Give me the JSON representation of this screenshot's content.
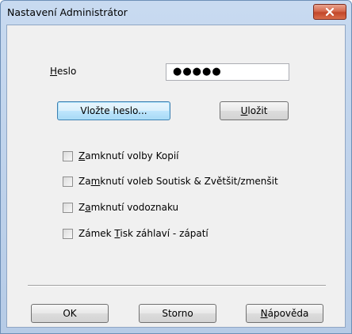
{
  "window": {
    "title": "Nastavení Administrátor"
  },
  "password": {
    "label_first": "H",
    "label_rest": "eslo",
    "value": "●●●●●"
  },
  "buttons": {
    "enter_password": "Vložte heslo...",
    "save_first": "U",
    "save_rest": "ložit",
    "ok": "OK",
    "cancel": "Storno",
    "help_first": "N",
    "help_rest": "ápověda"
  },
  "checkboxes": [
    {
      "pre": "",
      "key": "Z",
      "post": "amknutí volby Kopií",
      "checked": false
    },
    {
      "pre": "Za",
      "key": "m",
      "post": "knutí voleb Soutisk & Zvětšit/zmenšit",
      "checked": false
    },
    {
      "pre": "Z",
      "key": "a",
      "post": "mknutí vodoznaku",
      "checked": false
    },
    {
      "pre": "Zámek ",
      "key": "T",
      "post": "isk záhlaví - zápatí",
      "checked": false
    }
  ],
  "colors": {
    "title_bar": "#b6cbe6",
    "client_bg": "#f0f0f0",
    "close_button": "#c2462a",
    "focus_button": "#a7d9f5"
  }
}
